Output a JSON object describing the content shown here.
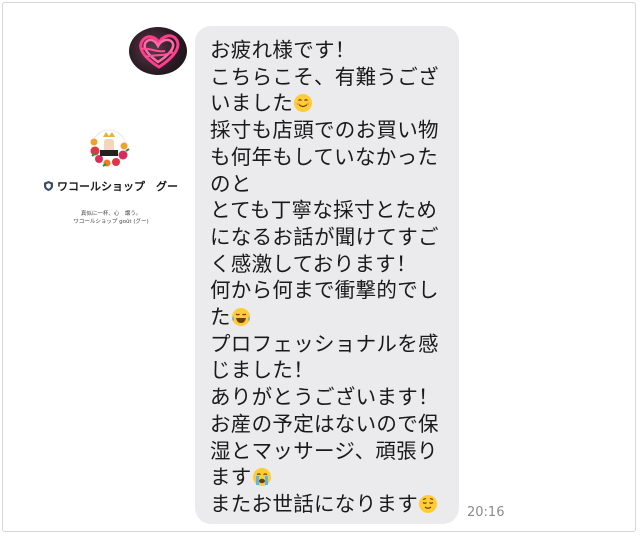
{
  "profile": {
    "name": "ワコールショップ　グー",
    "tagline": "真似に一杯、心　譲う。",
    "shop_line": "ワコールショップ goût (グー)"
  },
  "message": {
    "lines": [
      {
        "text": "お疲れ様です！",
        "emoji": ""
      },
      {
        "text": "こちらこそ、有難うござ",
        "emoji": ""
      },
      {
        "text": "いました",
        "emoji": "smiling-face-icon"
      },
      {
        "text": "採寸も店頭でのお買い物",
        "emoji": ""
      },
      {
        "text": "も何年もしていなかった",
        "emoji": ""
      },
      {
        "text": "のと",
        "emoji": ""
      },
      {
        "text": "とても丁寧な採寸とため",
        "emoji": ""
      },
      {
        "text": "になるお話が聞けてすご",
        "emoji": ""
      },
      {
        "text": "く感激しております！",
        "emoji": ""
      },
      {
        "text": "何から何まで衝撃的でし",
        "emoji": ""
      },
      {
        "text": "た",
        "emoji": "tears-of-joy-icon"
      },
      {
        "text": "プロフェッショナルを感",
        "emoji": ""
      },
      {
        "text": "じました！",
        "emoji": ""
      },
      {
        "text": "ありがとうございます！",
        "emoji": ""
      },
      {
        "text": "お産の予定はないので保",
        "emoji": ""
      },
      {
        "text": "湿とマッサージ、頑張り",
        "emoji": ""
      },
      {
        "text": "ます",
        "emoji": "crying-face-icon"
      },
      {
        "text": "またお世話になります",
        "emoji": "relieved-face-icon"
      }
    ],
    "time": "20:16"
  }
}
